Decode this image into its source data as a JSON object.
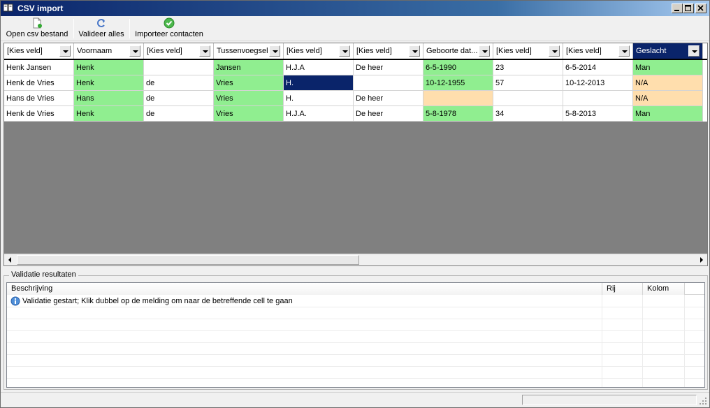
{
  "window": {
    "title": "CSV import"
  },
  "toolbar": {
    "open_label": "Open csv bestand",
    "validate_label": "Valideer alles",
    "import_label": "Importeer contacten"
  },
  "grid": {
    "columns": [
      "[Kies veld]",
      "Voornaam",
      "[Kies veld]",
      "Tussenvoegsel",
      "[Kies veld]",
      "[Kies veld]",
      "Geboorte dat...",
      "[Kies veld]",
      "[Kies veld]",
      "Geslacht"
    ],
    "rows": [
      [
        "Henk Jansen",
        "Henk",
        "",
        "Jansen",
        "H.J.A",
        "De heer",
        "6-5-1990",
        "23",
        "6-5-2014",
        "Man"
      ],
      [
        "Henk de Vries",
        "Henk",
        "de",
        "Vries",
        "H.",
        "",
        "10-12-1955",
        "57",
        "10-12-2013",
        "N/A"
      ],
      [
        "Hans de Vries",
        "Hans",
        "de",
        "Vries",
        "H.",
        "De heer",
        "",
        "",
        "",
        "N/A"
      ],
      [
        "Henk de Vries",
        "Henk",
        "de",
        "Vries",
        "H.J.A.",
        "De heer",
        "5-8-1978",
        "34",
        "5-8-2013",
        "Man"
      ]
    ]
  },
  "validation": {
    "group_title": "Validatie resultaten",
    "columns": {
      "description": "Beschrijving",
      "row": "Rij",
      "column": "Kolom"
    },
    "messages": [
      {
        "text": "Validatie gestart; Klik dubbel op de melding om naar de betreffende cell te gaan",
        "row": "",
        "column": ""
      }
    ]
  },
  "colors": {
    "valid": "#90ee90",
    "warning": "#ffdead",
    "selected": "#0a246a"
  }
}
